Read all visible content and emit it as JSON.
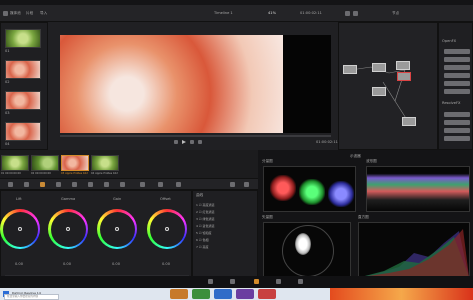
{
  "toolbar": {
    "left_labels": [
      "媒体池",
      "片段",
      "导入"
    ],
    "timeline_name": "Timeline 1",
    "timecode_center": "01:00:02:11",
    "zoom": "41%",
    "right_label": "节点"
  },
  "viewer": {
    "timecode": "01:00:02:11"
  },
  "colors": {
    "accent": "#d38b2b",
    "record_red": "#d43b3b",
    "panel_bg": "#1f1f22"
  },
  "gallery": {
    "clip_labels": [
      "01",
      "02",
      "03",
      "04"
    ]
  },
  "timeline_clips": [
    {
      "label": "01 00:00:00:00"
    },
    {
      "label": "02 00:00:00:00"
    },
    {
      "label": "03 Apple ProRes 422"
    },
    {
      "label": "04 Apple ProRes 422"
    }
  ],
  "wheels": [
    {
      "label": "Lift"
    },
    {
      "label": "Gamma"
    },
    {
      "label": "Gain"
    },
    {
      "label": "Offset"
    }
  ],
  "wheel_values": [
    "0.00",
    "0.00",
    "0.00",
    "0.00"
  ],
  "curves_panel": {
    "title": "曲线",
    "items": [
      "1 ☑ 亮度通道",
      "2 ☑ 红色通道",
      "3 ☑ 绿色通道",
      "4 ☑ 蓝色通道",
      "5 ☑ 饱和度",
      "6 ☑ 色相",
      "7 ☑ 亮度"
    ]
  },
  "scopes": {
    "title": "示波器",
    "labels": [
      "分量图",
      "波形图",
      "矢量图",
      "直方图"
    ]
  },
  "right_panel": {
    "section_a": "OpenFX",
    "section_b": "ResolveFX"
  },
  "taskbar": {
    "app_label": "DaVinci Resolve 14",
    "search_placeholder": "在这里输入你要搜索的内容"
  }
}
